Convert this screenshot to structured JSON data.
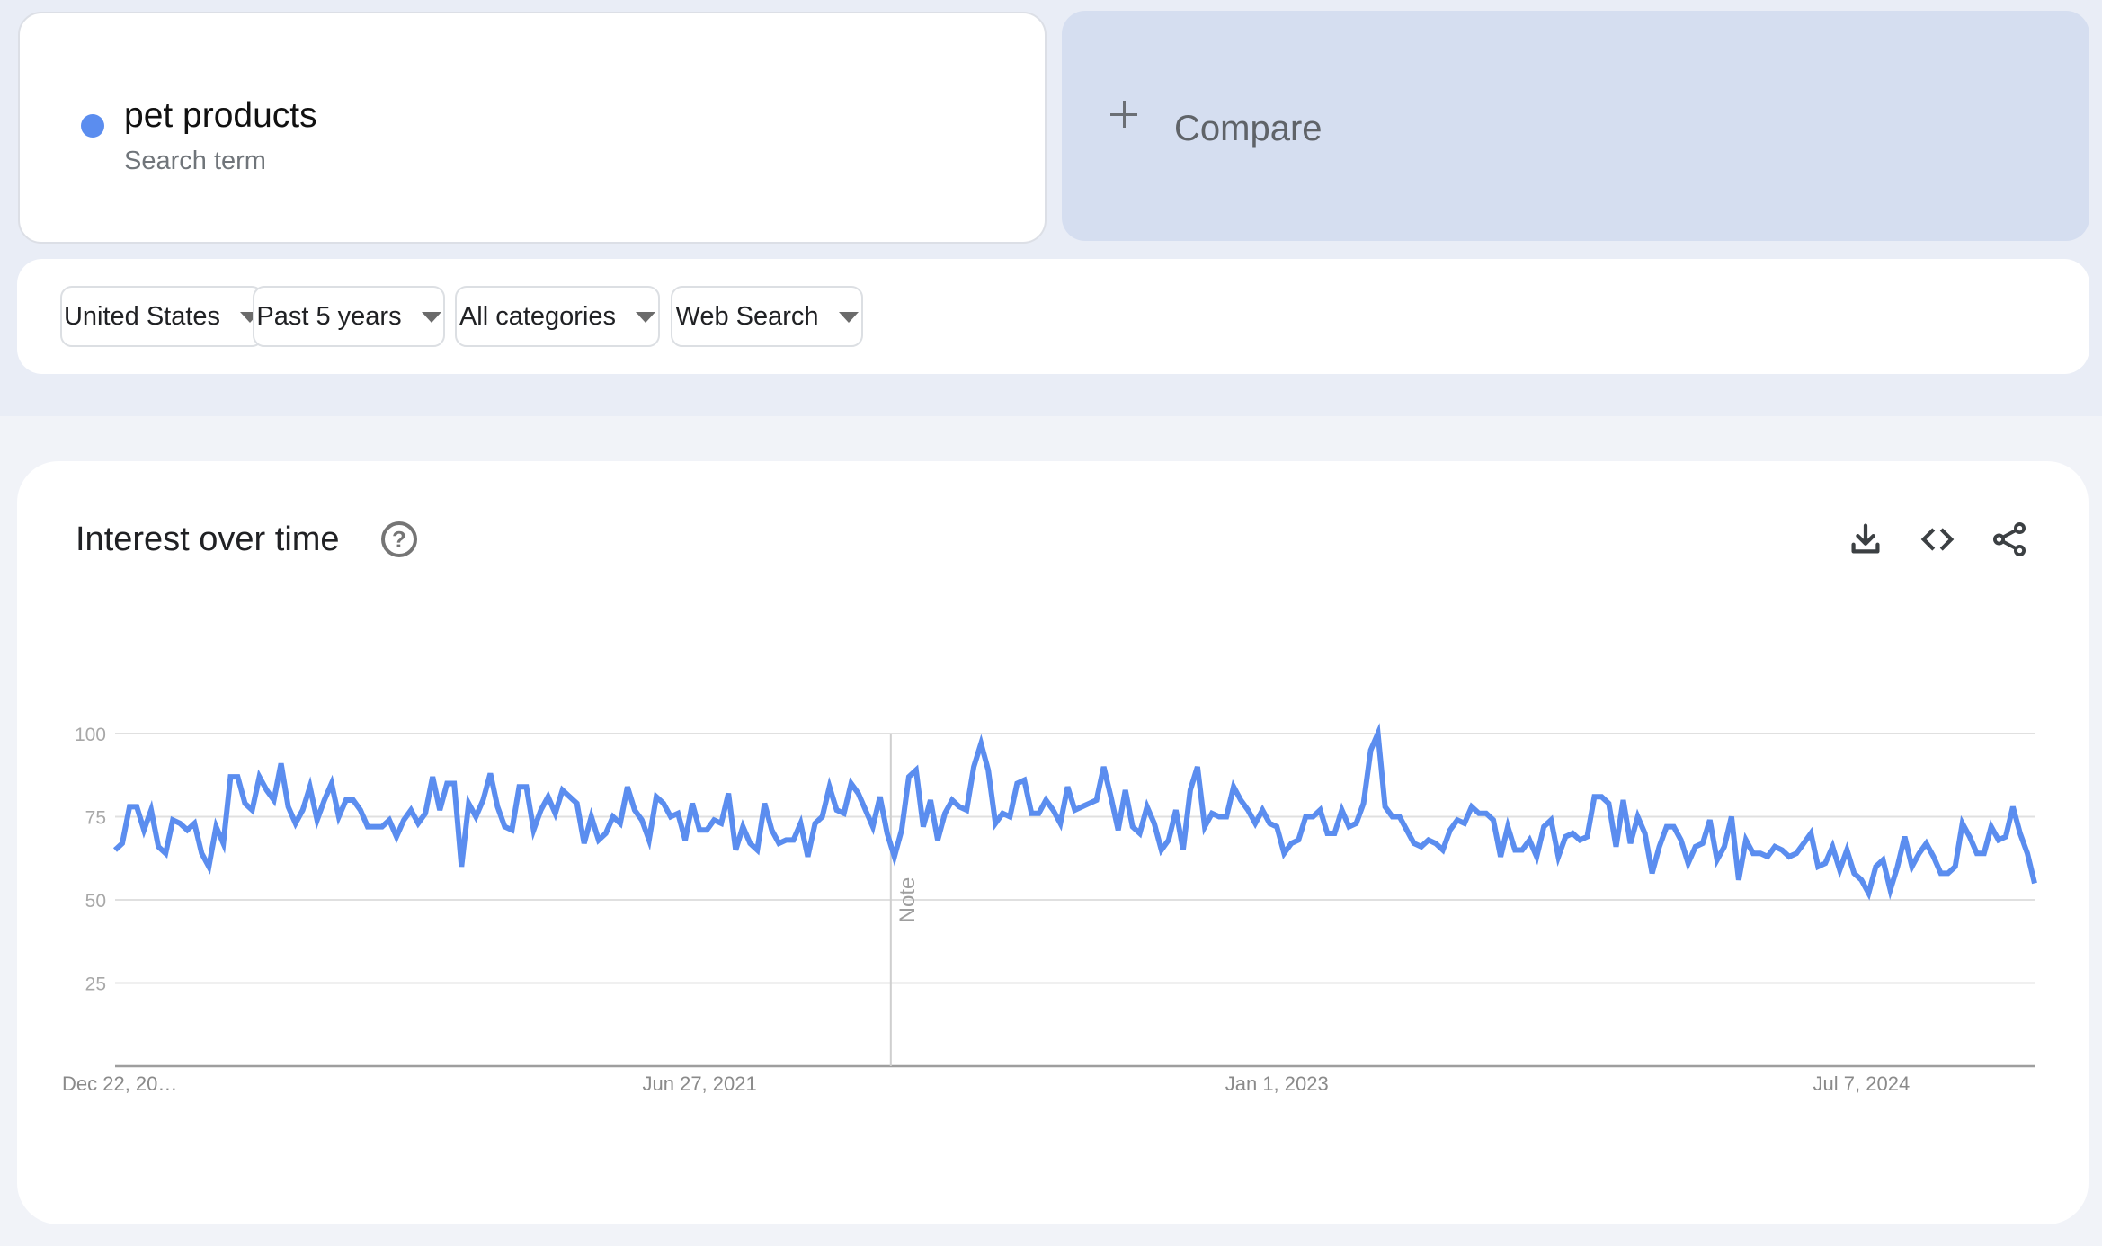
{
  "term_card": {
    "term": "pet products",
    "subtitle": "Search term",
    "series_color": "#5B8DEF"
  },
  "compare": {
    "label": "Compare"
  },
  "filters": [
    {
      "label": "United States"
    },
    {
      "label": "Past 5 years"
    },
    {
      "label": "All categories"
    },
    {
      "label": "Web Search"
    }
  ],
  "chart_header": {
    "title": "Interest over time",
    "help_icon": "help-circle-icon",
    "actions": [
      "download-icon",
      "embed-code-icon",
      "share-icon"
    ]
  },
  "chart_data": {
    "type": "line",
    "title": "Interest over time",
    "xlabel": "",
    "ylabel": "",
    "ylim": [
      0,
      100
    ],
    "yticks": [
      25,
      50,
      75,
      100
    ],
    "grid": true,
    "legend": "none",
    "x_labels": [
      {
        "text": "Dec 22, 20…",
        "index": 0,
        "align": "start"
      },
      {
        "text": "Jun 27, 2021",
        "index": 81,
        "align": "middle"
      },
      {
        "text": "Jan 1, 2023",
        "index": 161,
        "align": "middle"
      },
      {
        "text": "Jul 7, 2024",
        "index": 242,
        "align": "middle"
      }
    ],
    "annotation": {
      "text": "Note",
      "index": 107.5
    },
    "series": [
      {
        "name": "pet products",
        "color": "#5B8DEF",
        "values": [
          65,
          67,
          78,
          78,
          71,
          77,
          66,
          64,
          74,
          73,
          71,
          73,
          64,
          60,
          72,
          67,
          87,
          87,
          79,
          77,
          87,
          83,
          80,
          91,
          78,
          73,
          77,
          84,
          74,
          80,
          85,
          75,
          80,
          80,
          77,
          72,
          72,
          72,
          74,
          69,
          74,
          77,
          73,
          76,
          87,
          77,
          85,
          85,
          60,
          79,
          75,
          80,
          88,
          78,
          72,
          71,
          84,
          84,
          71,
          77,
          81,
          76,
          83,
          81,
          79,
          67,
          75,
          68,
          70,
          75,
          73,
          84,
          77,
          74,
          68,
          81,
          79,
          75,
          76,
          68,
          79,
          71,
          71,
          74,
          73,
          82,
          65,
          72,
          67,
          65,
          79,
          71,
          67,
          68,
          68,
          73,
          63,
          73,
          75,
          84,
          77,
          76,
          85,
          82,
          77,
          72,
          81,
          70,
          63,
          71,
          87,
          89,
          72,
          80,
          68,
          76,
          80,
          78,
          77,
          90,
          97,
          89,
          73,
          76,
          75,
          85,
          86,
          76,
          76,
          80,
          77,
          73,
          84,
          77,
          78,
          79,
          80,
          90,
          81,
          71,
          83,
          72,
          70,
          78,
          73,
          65,
          68,
          77,
          65,
          83,
          90,
          72,
          76,
          75,
          75,
          84,
          80,
          77,
          73,
          77,
          73,
          72,
          64,
          67,
          68,
          75,
          75,
          77,
          70,
          70,
          77,
          72,
          73,
          79,
          95,
          100,
          78,
          75,
          75,
          71,
          67,
          66,
          68,
          67,
          65,
          71,
          74,
          73,
          78,
          76,
          76,
          74,
          63,
          72,
          65,
          65,
          68,
          63,
          72,
          74,
          63,
          69,
          70,
          68,
          69,
          81,
          81,
          79,
          66,
          80,
          67,
          75,
          70,
          58,
          66,
          72,
          72,
          68,
          61,
          66,
          67,
          74,
          62,
          66,
          75,
          56,
          68,
          64,
          64,
          63,
          66,
          65,
          63,
          64,
          67,
          70,
          60,
          61,
          66,
          59,
          65,
          58,
          56,
          52,
          60,
          62,
          53,
          60,
          69,
          60,
          64,
          67,
          63,
          58,
          58,
          60,
          73,
          69,
          64,
          64,
          72,
          68,
          69,
          78,
          70,
          64,
          55
        ]
      }
    ]
  }
}
